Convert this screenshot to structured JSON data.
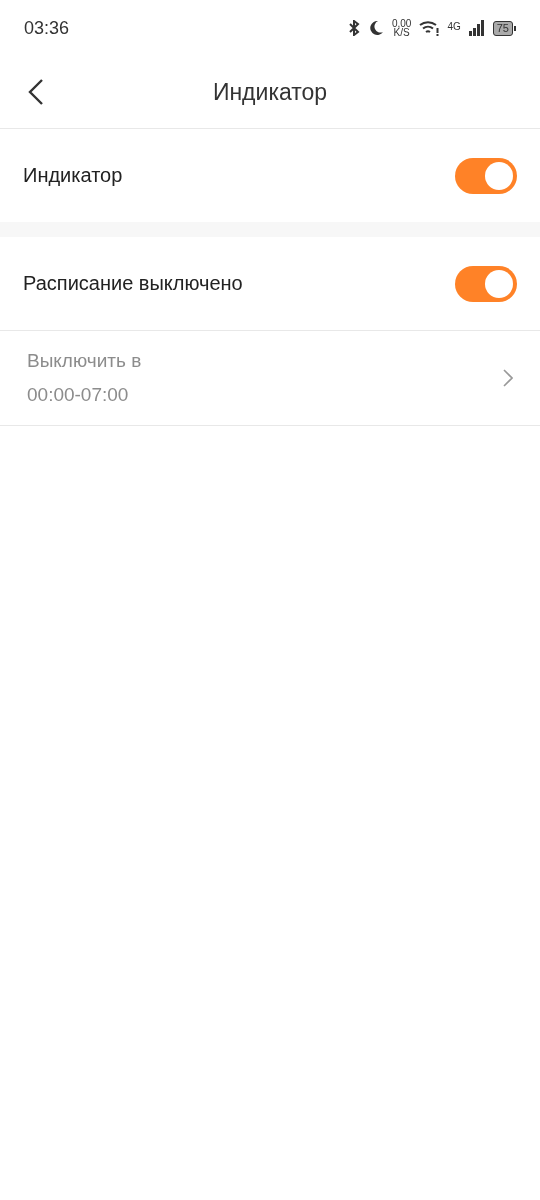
{
  "status_bar": {
    "time": "03:36",
    "net_speed": "0,00",
    "net_unit": "K/S",
    "network": "4G",
    "battery": "75"
  },
  "header": {
    "title": "Индикатор"
  },
  "sections": [
    {
      "rows": [
        {
          "kind": "toggle",
          "label": "Индикатор",
          "on": true
        }
      ]
    },
    {
      "rows": [
        {
          "kind": "toggle",
          "label": "Расписание выключено",
          "on": true
        },
        {
          "kind": "link",
          "label": "Выключить в",
          "value": "00:00-07:00",
          "disabled": true
        }
      ]
    }
  ]
}
